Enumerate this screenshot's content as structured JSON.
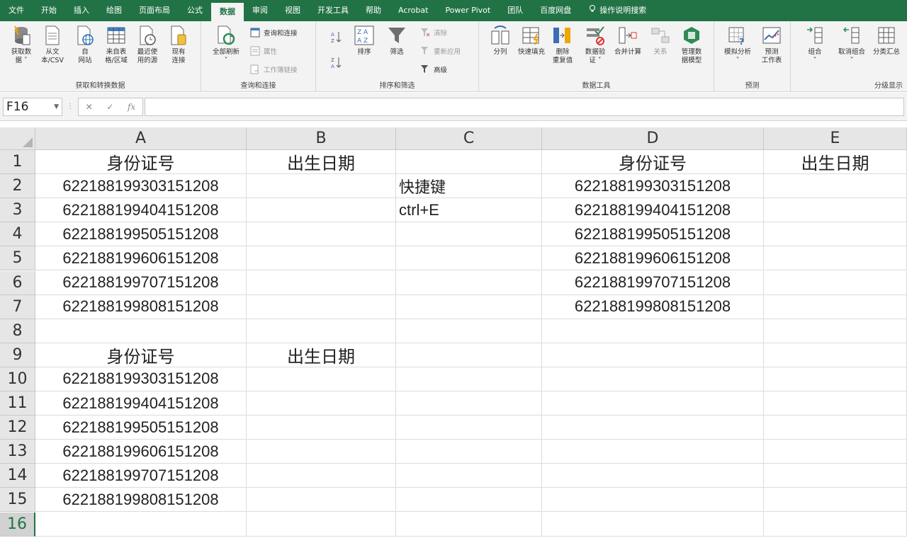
{
  "tabs": [
    "文件",
    "开始",
    "插入",
    "绘图",
    "页面布局",
    "公式",
    "数据",
    "审阅",
    "视图",
    "开发工具",
    "帮助",
    "Acrobat",
    "Power Pivot",
    "团队",
    "百度网盘"
  ],
  "active_tab_index": 6,
  "search_label": "操作说明搜索",
  "ribbon": {
    "groups": {
      "get_transform": {
        "label": "获取和转换数据",
        "buttons": [
          "获取数\n据 ˅",
          "从文\n本/CSV",
          "自\n网站",
          "来自表\n格/区域",
          "最近使\n用的源",
          "现有\n连接"
        ]
      },
      "queries": {
        "label": "查询和连接",
        "refresh": "全部刷新\n˅",
        "items": [
          "查询和连接",
          "属性",
          "工作簿链接"
        ]
      },
      "sort_filter": {
        "label": "排序和筛选",
        "sort": "排序",
        "filter": "筛选",
        "items": [
          "清除",
          "重新应用",
          "高级"
        ]
      },
      "data_tools": {
        "label": "数据工具",
        "buttons": [
          "分列",
          "快速填充",
          "删除\n重复值",
          "数据验\n证 ˅",
          "合并计算",
          "关系",
          "管理数\n据模型"
        ]
      },
      "forecast": {
        "label": "预测",
        "buttons": [
          "模拟分析\n˅",
          "预测\n工作表"
        ]
      },
      "outline": {
        "label": "分级显示",
        "buttons": [
          "组合\n˅",
          "取消组合\n˅",
          "分类汇总"
        ]
      }
    }
  },
  "name_box": "F16",
  "formula_value": "",
  "columns": [
    "A",
    "B",
    "C",
    "D",
    "E"
  ],
  "rows": [
    [
      "身份证号",
      "出生日期",
      "",
      "身份证号",
      "出生日期"
    ],
    [
      "622188199303151208",
      "",
      "快捷键",
      "622188199303151208",
      ""
    ],
    [
      "622188199404151208",
      "",
      "ctrl+E",
      "622188199404151208",
      ""
    ],
    [
      "622188199505151208",
      "",
      "",
      "622188199505151208",
      ""
    ],
    [
      "622188199606151208",
      "",
      "",
      "622188199606151208",
      ""
    ],
    [
      "622188199707151208",
      "",
      "",
      "622188199707151208",
      ""
    ],
    [
      "622188199808151208",
      "",
      "",
      "622188199808151208",
      ""
    ],
    [
      "",
      "",
      "",
      "",
      ""
    ],
    [
      "身份证号",
      "出生日期",
      "",
      "",
      ""
    ],
    [
      "622188199303151208",
      "",
      "",
      "",
      ""
    ],
    [
      "622188199404151208",
      "",
      "",
      "",
      ""
    ],
    [
      "622188199505151208",
      "",
      "",
      "",
      ""
    ],
    [
      "622188199606151208",
      "",
      "",
      "",
      ""
    ],
    [
      "622188199707151208",
      "",
      "",
      "",
      ""
    ],
    [
      "622188199808151208",
      "",
      "",
      "",
      ""
    ],
    [
      "",
      "",
      "",
      "",
      ""
    ]
  ],
  "row_numbers": [
    "1",
    "2",
    "3",
    "4",
    "5",
    "6",
    "7",
    "8",
    "9",
    "10",
    "11",
    "12",
    "13",
    "14",
    "15",
    "16"
  ],
  "colors": {
    "accent": "#217346",
    "ribbon_bg": "#f3f3f3",
    "header_bg": "#e6e6e6"
  }
}
